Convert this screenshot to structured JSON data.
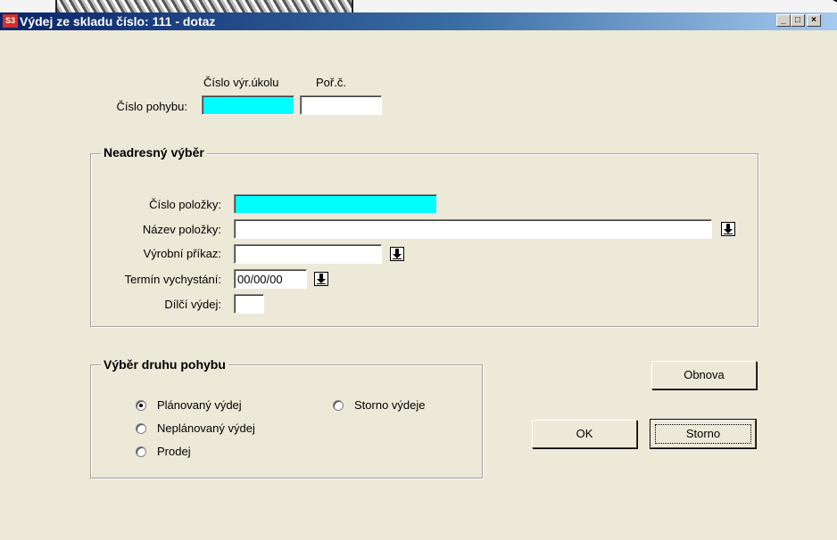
{
  "window": {
    "title": "Výdej ze skladu číslo: 111  - dotaz",
    "app_icon_text": "S3",
    "caption_buttons": {
      "minimize": "_",
      "maximize": "□",
      "close": "×"
    }
  },
  "header_fields": {
    "col_header_task": "Číslo výr.úkolu",
    "col_header_order": "Poř.č.",
    "movement_label": "Číslo pohybu:",
    "task_value": "",
    "order_value": ""
  },
  "group_nonaddress": {
    "title": "Neadresný výběr",
    "item_number_label": "Číslo položky:",
    "item_number_value": "",
    "item_name_label": "Název položky:",
    "item_name_value": "",
    "production_order_label": "Výrobní příkaz:",
    "production_order_value": "",
    "pick_date_label": "Termín vychystání:",
    "pick_date_value": "00/00/00",
    "partial_issue_label": "Dílčí výdej:",
    "partial_issue_value": ""
  },
  "group_movement_type": {
    "title": "Výběr druhu pohybu",
    "options": [
      {
        "label": "Plánovaný výdej",
        "selected": true
      },
      {
        "label": "Storno výdeje",
        "selected": false
      },
      {
        "label": "Neplánovaný výdej",
        "selected": false
      },
      {
        "label": "Prodej",
        "selected": false
      }
    ]
  },
  "buttons": {
    "refresh": "Obnova",
    "ok": "OK",
    "cancel": "Storno"
  },
  "colors": {
    "required_field": "#00ffff",
    "window_bg": "#ece9d8",
    "title_bar_start": "#0a246a",
    "title_bar_end": "#a6caf0"
  }
}
